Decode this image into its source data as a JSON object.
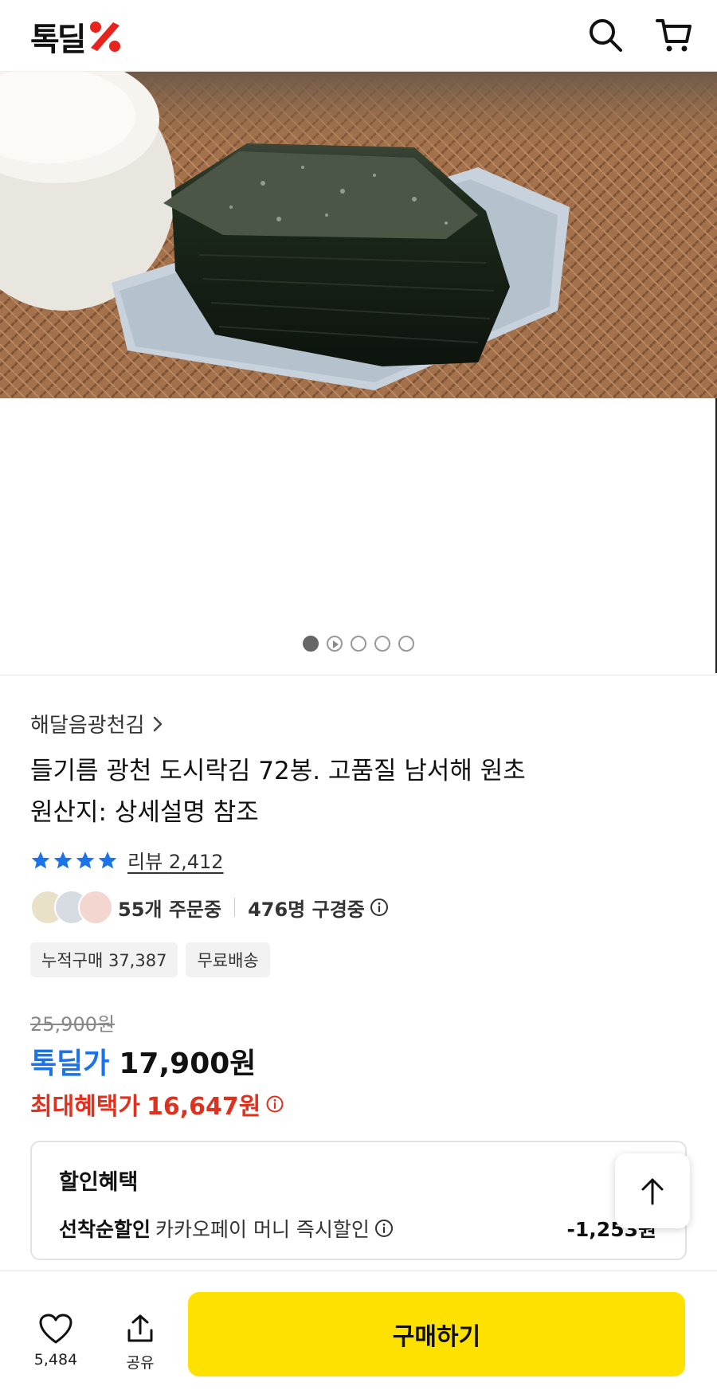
{
  "header": {
    "logo_text": "톡딜",
    "logo_icon": "percent-mark",
    "search_icon": "search-icon",
    "cart_icon": "cart-icon"
  },
  "gallery": {
    "image_count": 5,
    "active_index": 0,
    "video_index": 1
  },
  "product": {
    "brand": "해달음광천김",
    "title_line1": "들기름 광천 도시락김 72봉. 고품질 남서해 원초",
    "title_line2": "원산지: 상세설명 참조",
    "rating_stars": 4,
    "review_label": "리뷰",
    "review_count": "2,412",
    "orders_text": "55개 주문중",
    "viewers_text": "476명 구경중",
    "chips": [
      "누적구매 37,387",
      "무료배송"
    ]
  },
  "price": {
    "original": "25,900원",
    "deal_label": "톡딜가",
    "deal_price": "17,900원",
    "max_label": "최대혜택가",
    "max_price": "16,647원"
  },
  "benefit": {
    "title": "할인혜택",
    "row_strong": "선착순할인",
    "row_normal": "카카오페이 머니 즉시할인",
    "amount": "-1,253원"
  },
  "bottom_bar": {
    "like_count": "5,484",
    "share_label": "공유",
    "buy_label": "구매하기"
  },
  "colors": {
    "deal_blue": "#1a73e8",
    "max_red": "#e0301e",
    "buy_yellow": "#ffe100",
    "star_blue": "#1a73e8",
    "logo_red": "#e8231e"
  }
}
